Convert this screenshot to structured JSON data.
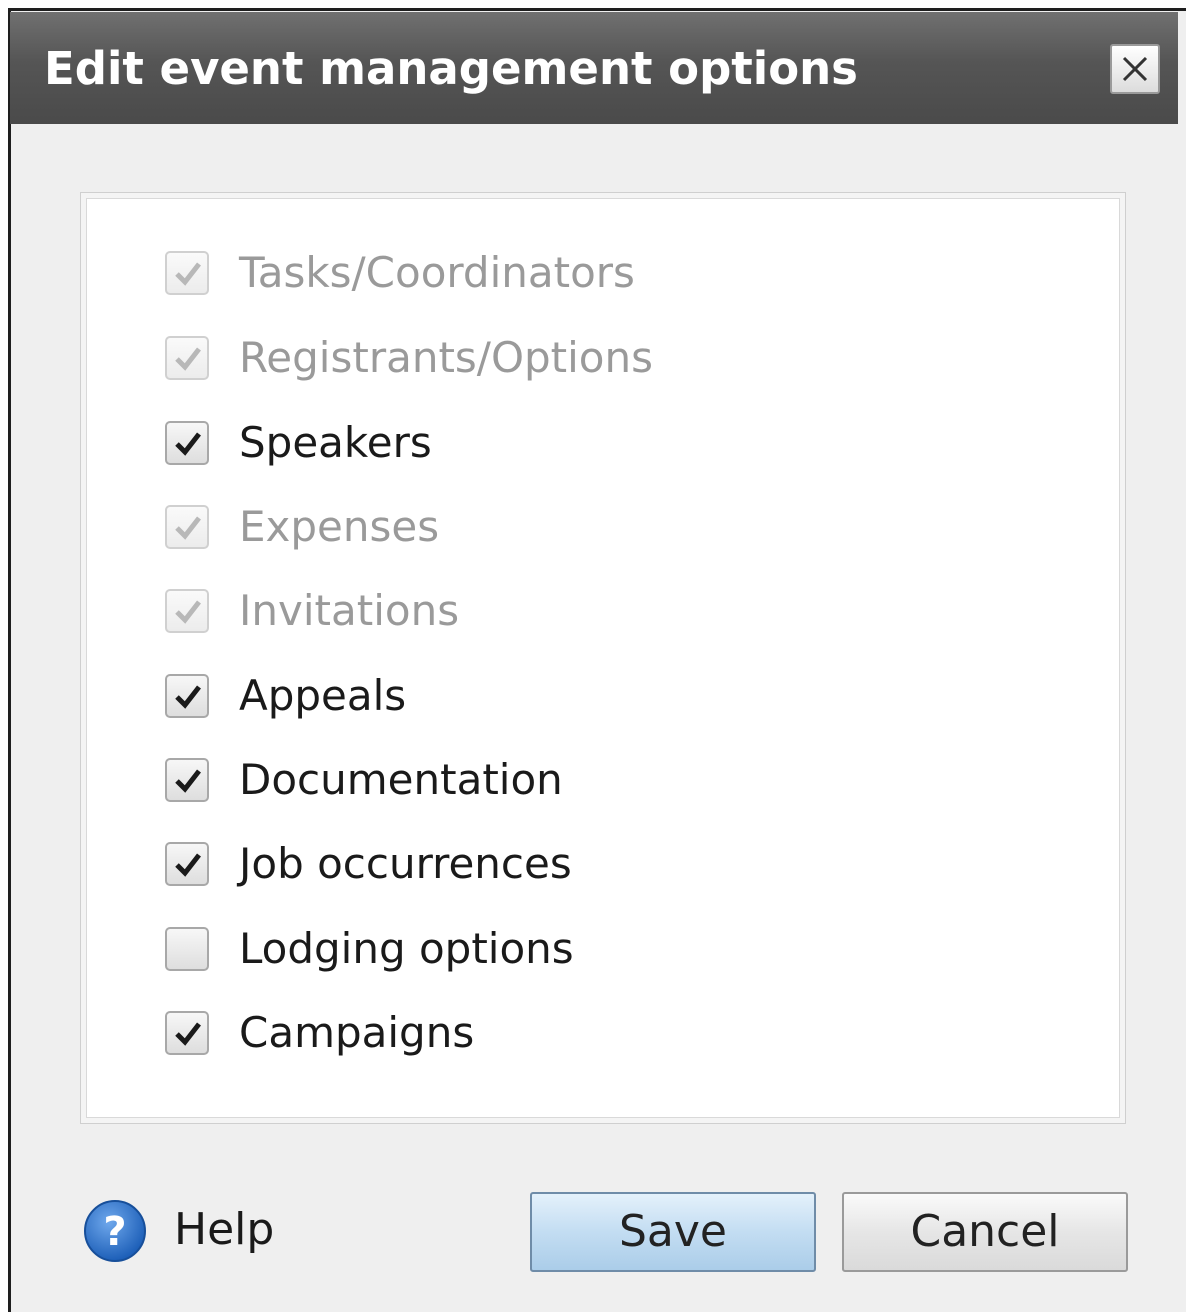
{
  "dialog": {
    "title": "Edit event management options",
    "close_icon": "close-icon"
  },
  "options": [
    {
      "label": "Tasks/Coordinators",
      "checked": true,
      "disabled": true
    },
    {
      "label": "Registrants/Options",
      "checked": true,
      "disabled": true
    },
    {
      "label": "Speakers",
      "checked": true,
      "disabled": false
    },
    {
      "label": "Expenses",
      "checked": true,
      "disabled": true
    },
    {
      "label": "Invitations",
      "checked": true,
      "disabled": true
    },
    {
      "label": "Appeals",
      "checked": true,
      "disabled": false
    },
    {
      "label": "Documentation",
      "checked": true,
      "disabled": false
    },
    {
      "label": "Job occurrences",
      "checked": true,
      "disabled": false
    },
    {
      "label": "Lodging options",
      "checked": false,
      "disabled": false
    },
    {
      "label": "Campaigns",
      "checked": true,
      "disabled": false
    }
  ],
  "footer": {
    "help_label": "Help",
    "help_icon": "help-icon",
    "save_label": "Save",
    "cancel_label": "Cancel"
  },
  "colors": {
    "title_bar": "#555555",
    "title_text": "#ffffff",
    "disabled_text": "#9a9a9a",
    "enabled_text": "#1a1a1a",
    "save_button": "#c3ddf2",
    "help_icon": "#2a6fc9"
  }
}
